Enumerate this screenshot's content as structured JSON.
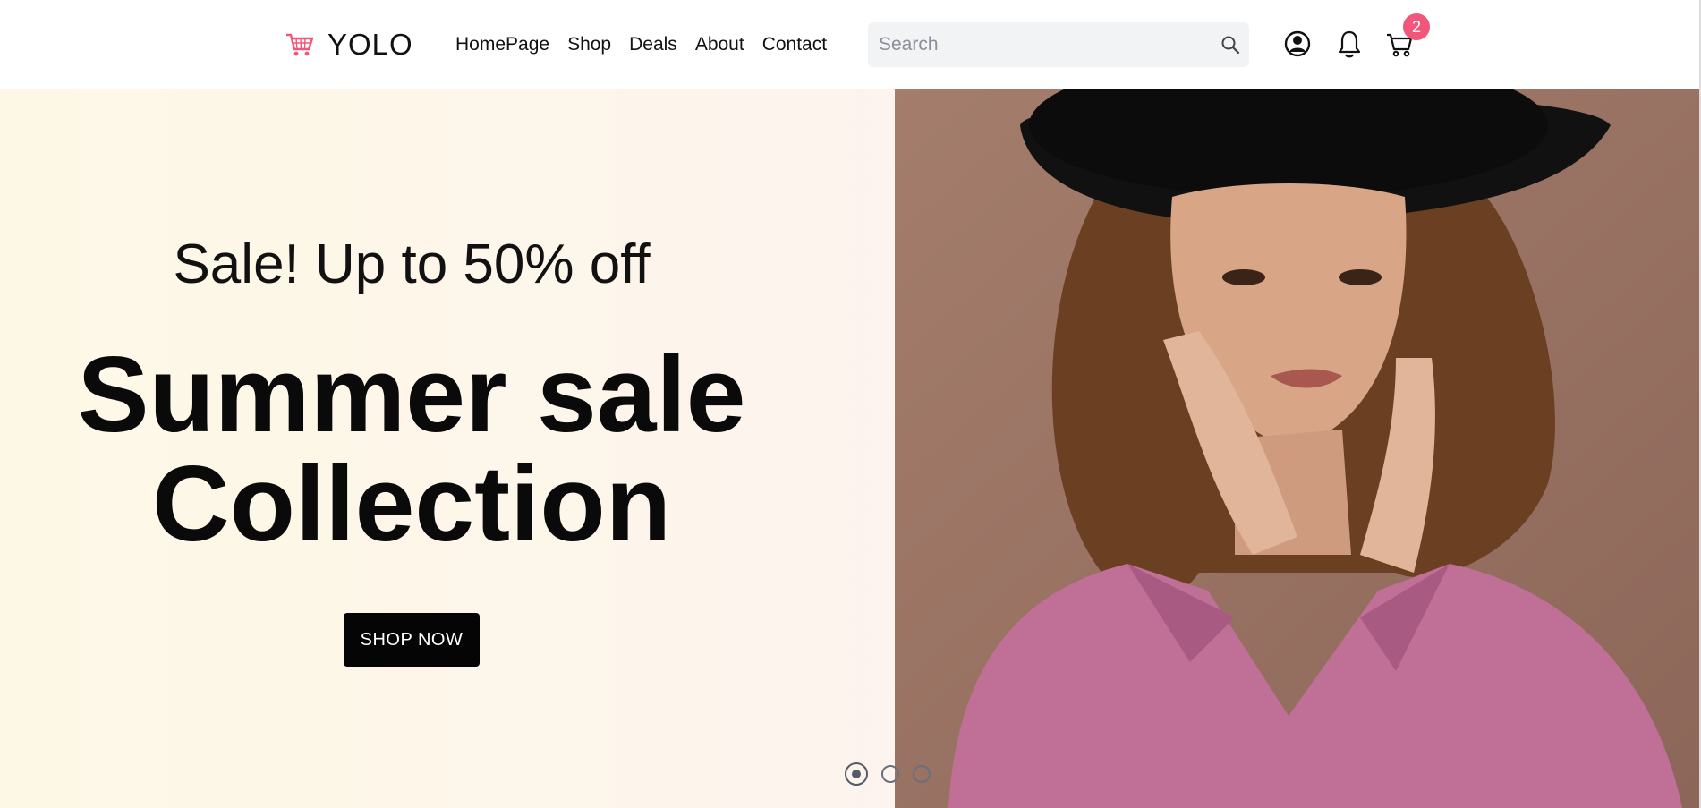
{
  "header": {
    "logo_text": "YOLO",
    "nav": [
      "HomePage",
      "Shop",
      "Deals",
      "About",
      "Contact"
    ],
    "search_placeholder": "Search",
    "cart_count": "2"
  },
  "hero": {
    "sale_text": "Sale! Up to 50% off",
    "headline_line1": "Summer sale",
    "headline_line2": "Collection",
    "button_label": "SHOP NOW",
    "active_slide": 1,
    "slide_count": 3
  },
  "colors": {
    "accent": "#f0577a",
    "button": "#050505"
  }
}
